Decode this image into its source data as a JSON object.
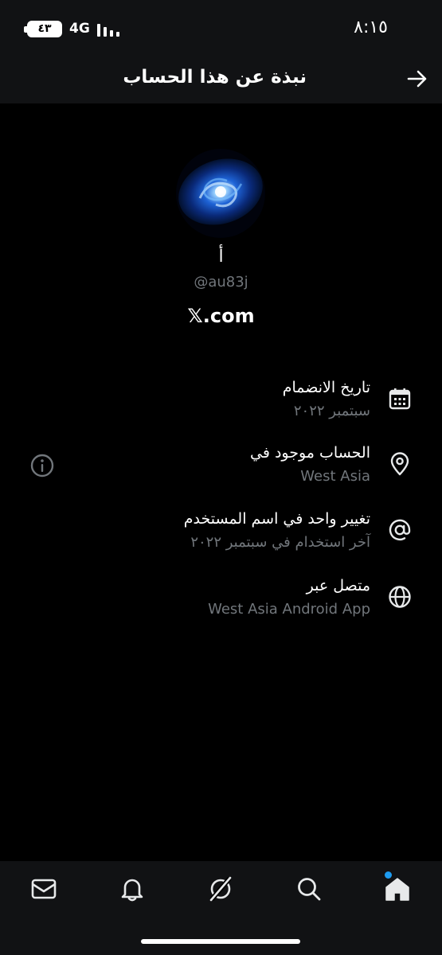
{
  "status_bar": {
    "time": "٨:١٥",
    "battery": "٤٣",
    "network": "4G"
  },
  "header": {
    "title": "نبذة عن هذا الحساب",
    "back_icon": "arrow-right-icon"
  },
  "profile": {
    "avatar": "galaxy-avatar",
    "display_name": "أ",
    "handle": "@au83j",
    "website": "𝕏.com"
  },
  "details": [
    {
      "icon": "calendar-icon",
      "title": "تاريخ الانضمام",
      "subtitle": "سبتمبر ٢٠٢٢"
    },
    {
      "icon": "location-pin-icon",
      "title": "الحساب موجود في",
      "subtitle": "West Asia"
    },
    {
      "icon": "at-sign-icon",
      "title": "تغيير واحد في اسم المستخدم",
      "subtitle": "آخر استخدام في سبتمبر ٢٠٢٢"
    },
    {
      "icon": "globe-icon",
      "title": "متصل عبر",
      "subtitle": "West Asia Android App"
    }
  ],
  "bottom_nav": [
    "mail-icon",
    "bell-icon",
    "grok-icon",
    "search-icon",
    "home-icon"
  ],
  "colors": {
    "background": "#000000",
    "bar": "#111214",
    "text": "#ffffff",
    "muted": "#71767b",
    "accent": "#1d9bf0"
  }
}
